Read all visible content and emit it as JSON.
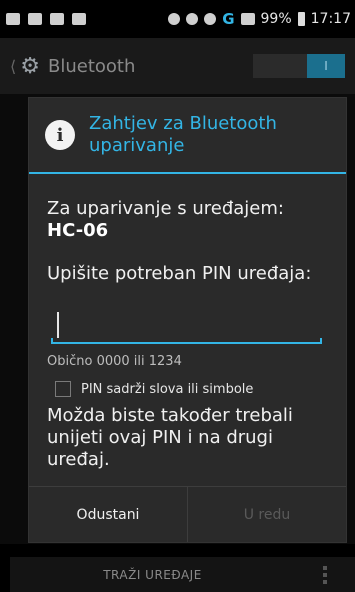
{
  "status_bar": {
    "battery": "99%",
    "time": "17:17",
    "network": "G"
  },
  "action_bar": {
    "title": "Bluetooth",
    "toggle_label": "I"
  },
  "dialog": {
    "title": "Zahtjev za Bluetooth uparivanje",
    "pair_prompt": "Za uparivanje s uređajem:",
    "device_name": "HC-06",
    "pin_prompt": "Upišite potreban PIN uređaja:",
    "pin_value": "",
    "pin_hint": "Obično 0000 ili 1234",
    "checkbox_label": "PIN sadrži slova ili simbole",
    "checkbox_checked": false,
    "note": "Možda biste također trebali unijeti ovaj PIN i na drugi uređaj.",
    "cancel_label": "Odustani",
    "ok_label": "U redu"
  },
  "bottom_bar": {
    "scan_label": "TRAŽI UREĐAJE"
  },
  "colors": {
    "accent": "#33b5e5",
    "dialog_bg": "#2a2a2a"
  }
}
